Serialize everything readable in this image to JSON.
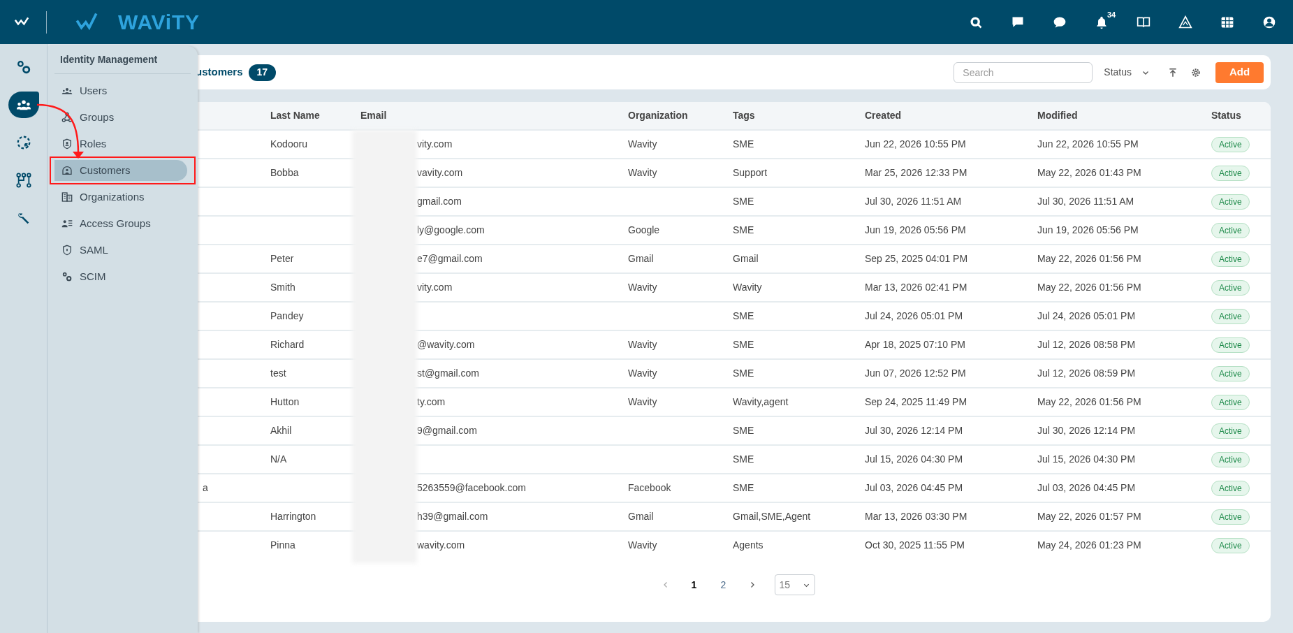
{
  "topbar": {
    "brand": "WAViTY",
    "notification_count": "34"
  },
  "rail": [
    {
      "kind": "settings",
      "selected": false
    },
    {
      "kind": "users",
      "selected": true
    },
    {
      "kind": "sync",
      "selected": false
    },
    {
      "kind": "workflow",
      "selected": false
    },
    {
      "kind": "tools",
      "selected": false
    }
  ],
  "menu": {
    "title": "Identity Management",
    "items": [
      {
        "label": "Users",
        "kind": "users",
        "selected": false,
        "annotated": false
      },
      {
        "label": "Groups",
        "kind": "groups",
        "selected": false,
        "annotated": false
      },
      {
        "label": "Roles",
        "kind": "roles",
        "selected": false,
        "annotated": false
      },
      {
        "label": "Customers",
        "kind": "customers",
        "selected": true,
        "annotated": true
      },
      {
        "label": "Organizations",
        "kind": "organizations",
        "selected": false,
        "annotated": false
      },
      {
        "label": "Access Groups",
        "kind": "access",
        "selected": false,
        "annotated": false
      },
      {
        "label": "SAML",
        "kind": "saml",
        "selected": false,
        "annotated": false
      },
      {
        "label": "SCIM",
        "kind": "settings",
        "selected": false,
        "annotated": false
      }
    ]
  },
  "header": {
    "title": "ustomers",
    "count": "17",
    "search": {
      "placeholder": "Search"
    },
    "status_filter": "Status",
    "add_button": "Add"
  },
  "table": {
    "columns": [
      "Last Name",
      "Email",
      "Organization",
      "Tags",
      "Created",
      "Modified",
      "Status"
    ],
    "rows": [
      {
        "last_name": "Kodooru",
        "email": "vity.com",
        "organization": "Wavity",
        "tags": "SME",
        "created": "Jun 22, 2026 10:55 PM",
        "modified": "Jun 22, 2026 10:55 PM",
        "status": "Active"
      },
      {
        "last_name": "Bobba",
        "email": "vavity.com",
        "organization": "Wavity",
        "tags": "Support",
        "created": "Mar 25, 2026 12:33 PM",
        "modified": "May 22, 2026 01:43 PM",
        "status": "Active"
      },
      {
        "email": "gmail.com",
        "tags": "SME",
        "created": "Jul 30, 2026 11:51 AM",
        "modified": "Jul 30, 2026 11:51 AM",
        "status": "Active"
      },
      {
        "email": "ly@google.com",
        "organization": "Google",
        "tags": "SME",
        "created": "Jun 19, 2026 05:56 PM",
        "modified": "Jun 19, 2026 05:56 PM",
        "status": "Active"
      },
      {
        "last_name": "Peter",
        "email": "e7@gmail.com",
        "organization": "Gmail",
        "tags": "Gmail",
        "created": "Sep 25, 2025 04:01 PM",
        "modified": "May 22, 2026 01:56 PM",
        "status": "Active"
      },
      {
        "last_name": "Smith",
        "email": "vity.com",
        "organization": "Wavity",
        "tags": "Wavity",
        "created": "Mar 13, 2026 02:41 PM",
        "modified": "May 22, 2026 01:56 PM",
        "status": "Active"
      },
      {
        "last_name": "Pandey",
        "tags": "SME",
        "created": "Jul 24, 2026 05:01 PM",
        "modified": "Jul 24, 2026 05:01 PM",
        "status": "Active"
      },
      {
        "last_name": "Richard",
        "email": "@wavity.com",
        "organization": "Wavity",
        "tags": "SME",
        "created": "Apr 18, 2025 07:10 PM",
        "modified": "Jul 12, 2026 08:58 PM",
        "status": "Active"
      },
      {
        "last_name": "test",
        "email": "st@gmail.com",
        "organization": "Wavity",
        "tags": "SME",
        "created": "Jun 07, 2026 12:52 PM",
        "modified": "Jul 12, 2026 08:59 PM",
        "status": "Active"
      },
      {
        "last_name": "Hutton",
        "email": "ty.com",
        "organization": "Wavity",
        "tags": "Wavity,agent",
        "created": "Sep 24, 2025 11:49 PM",
        "modified": "May 22, 2026 01:56 PM",
        "status": "Active"
      },
      {
        "last_name": "Akhil",
        "email": "9@gmail.com",
        "tags": "SME",
        "created": "Jul 30, 2026 12:14 PM",
        "modified": "Jul 30, 2026 12:14 PM",
        "status": "Active"
      },
      {
        "last_name": "N/A",
        "tags": "SME",
        "created": "Jul 15, 2026 04:30 PM",
        "modified": "Jul 15, 2026 04:30 PM",
        "status": "Active"
      },
      {
        "column_1": "a",
        "email": "5263559@facebook.com",
        "organization": "Facebook",
        "tags": "SME",
        "created": "Jul 03, 2026 04:45 PM",
        "modified": "Jul 03, 2026 04:45 PM",
        "status": "Active"
      },
      {
        "last_name": "Harrington",
        "email": "h39@gmail.com",
        "organization": "Gmail",
        "tags": "Gmail,SME,Agent",
        "created": "Mar 13, 2026 03:30 PM",
        "modified": "May 22, 2026 01:57 PM",
        "status": "Active"
      },
      {
        "last_name": "Pinna",
        "email": "wavity.com",
        "organization": "Wavity",
        "tags": "Agents",
        "created": "Oct 30, 2025 11:55 PM",
        "modified": "May 24, 2026 01:23 PM",
        "status": "Active"
      }
    ]
  },
  "pagination": {
    "pages": [
      {
        "label": "1",
        "selected": true
      },
      {
        "label": "2",
        "selected": false
      }
    ],
    "page_size": "15"
  }
}
